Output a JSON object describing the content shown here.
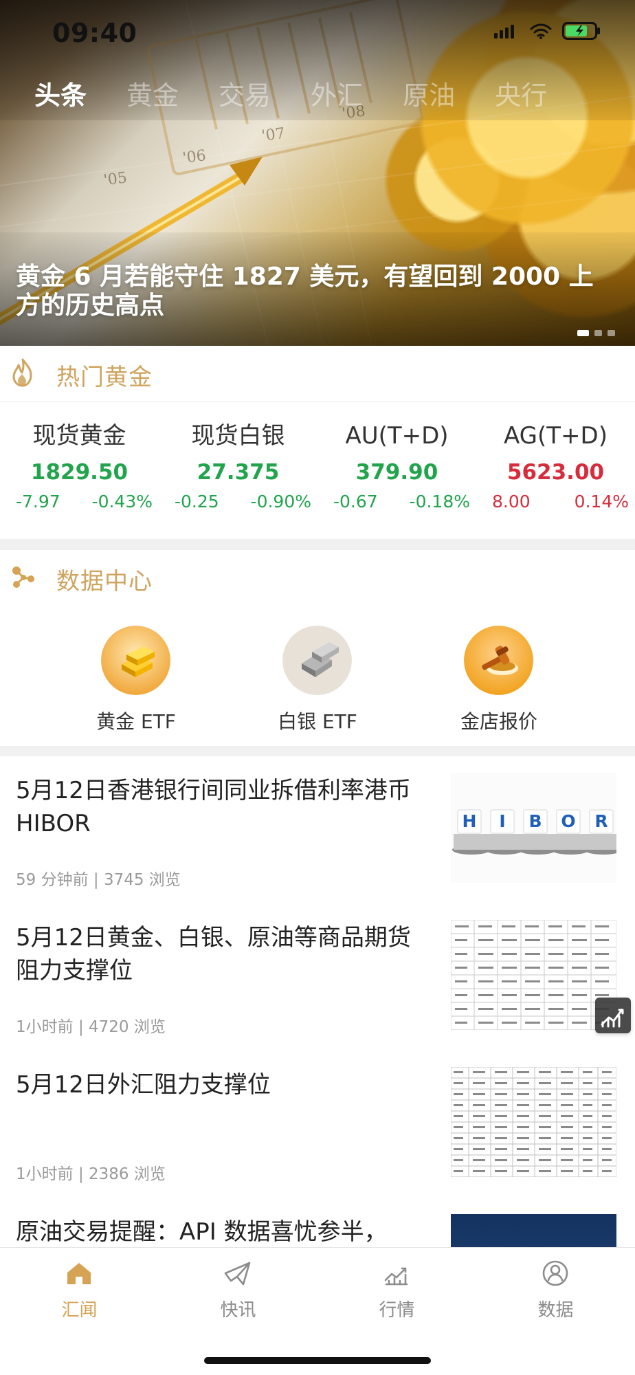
{
  "status_bar": {
    "time": "09:40",
    "icons": [
      "signal-icon",
      "wifi-icon",
      "battery-icon"
    ]
  },
  "top_tabs": [
    {
      "label": "头条",
      "active": true
    },
    {
      "label": "黄金"
    },
    {
      "label": "交易"
    },
    {
      "label": "外汇"
    },
    {
      "label": "原油"
    },
    {
      "label": "央行"
    }
  ],
  "hero": {
    "headline": "黄金 6 月若能守住 1827 美元，有望回到 2000 上方的历史高点",
    "carousel_index": 1,
    "carousel_count": 3
  },
  "hot_gold": {
    "title": "热门黄金",
    "items": [
      {
        "name": "现货黄金",
        "price": "1829.50",
        "change": "-7.97",
        "change_pct": "-0.43%",
        "trend": "down"
      },
      {
        "name": "现货白银",
        "price": "27.375",
        "change": "-0.25",
        "change_pct": "-0.90%",
        "trend": "down"
      },
      {
        "name": "AU(T+D)",
        "price": "379.90",
        "change": "-0.67",
        "change_pct": "-0.18%",
        "trend": "down"
      },
      {
        "name": "AG(T+D)",
        "price": "5623.00",
        "change": "8.00",
        "change_pct": "0.14%",
        "trend": "up"
      }
    ]
  },
  "data_center": {
    "title": "数据中心",
    "items": [
      {
        "label": "黄金 ETF",
        "icon": "gold-bar-icon"
      },
      {
        "label": "白银 ETF",
        "icon": "silver-bar-icon"
      },
      {
        "label": "金店报价",
        "icon": "gavel-icon"
      }
    ]
  },
  "news": [
    {
      "title": "5月12日香港银行间同业拆借利率港币 HIBOR",
      "time": "59 分钟前",
      "views": "3745 浏览",
      "thumb_text": [
        "H",
        "I",
        "B",
        "O",
        "R"
      ]
    },
    {
      "title": "5月12日黄金、白银、原油等商品期货阻力支撑位",
      "time": "1小时前",
      "views": "4720 浏览"
    },
    {
      "title": "5月12日外汇阻力支撑位",
      "time": "1小时前",
      "views": "2386 浏览"
    },
    {
      "title": "原油交易提醒：API 数据喜忧参半，",
      "time": "",
      "views": ""
    }
  ],
  "bottom_nav": [
    {
      "label": "汇闻",
      "active": true,
      "icon": "home-icon"
    },
    {
      "label": "快讯",
      "icon": "paper-plane-icon"
    },
    {
      "label": "行情",
      "icon": "chart-icon"
    },
    {
      "label": "数据",
      "icon": "user-icon"
    }
  ],
  "colors": {
    "gold": "#d6a354",
    "gold_light": "#cfa45f",
    "down": "#21a44c",
    "up": "#d62d3d",
    "muted": "#9a9a9a",
    "divider": "#f1f1f1"
  }
}
